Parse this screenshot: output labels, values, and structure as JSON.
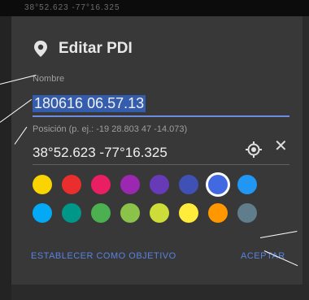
{
  "topbar": {
    "coords_text": "38°52.623 -77°16.325"
  },
  "dialog": {
    "title": "Editar PDI",
    "name_label": "Nombre",
    "name_value": "180616 06.57.13",
    "position_label": "Posición (p. ej.: -19 28.803 47 -14.073)",
    "position_value": "38°52.623 -77°16.325",
    "colors_row1": [
      "#f9d400",
      "#ea2e2e",
      "#e91e63",
      "#9c27b0",
      "#673ab7",
      "#3f51b5",
      "#4169e1",
      "#2196f3"
    ],
    "colors_row2": [
      "#03a9f4",
      "#009688",
      "#4caf50",
      "#8bc34a",
      "#cddc39",
      "#ffeb3b",
      "#ff9800",
      "#607d8b"
    ],
    "selected_color_index": 6,
    "button_objective": "ESTABLECER COMO OBJETIVO",
    "button_accept": "ACEPTAR"
  },
  "icons": {
    "pin": "map-pin-icon",
    "gps": "gps-locate-icon",
    "close": "close-icon"
  },
  "colors": {
    "accent": "#5a82e0",
    "name_highlight": "#355dae"
  }
}
